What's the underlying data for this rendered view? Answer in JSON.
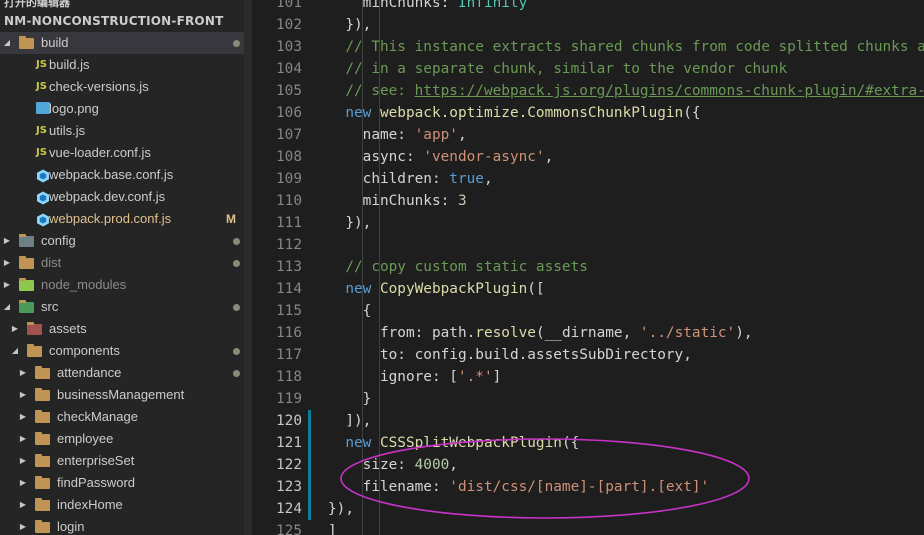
{
  "explorer": {
    "cut_header": "打开的编辑器",
    "project": "NM-NONCONSTRUCTION-FRONT",
    "items": [
      {
        "label": "build",
        "type": "folder",
        "level": 0,
        "open": true,
        "active": true,
        "status": "dot"
      },
      {
        "label": "build.js",
        "type": "js",
        "level": 1
      },
      {
        "label": "check-versions.js",
        "type": "js",
        "level": 1
      },
      {
        "label": "logo.png",
        "type": "image",
        "level": 1
      },
      {
        "label": "utils.js",
        "type": "js",
        "level": 1
      },
      {
        "label": "vue-loader.conf.js",
        "type": "js",
        "level": 1
      },
      {
        "label": "webpack.base.conf.js",
        "type": "webpack",
        "level": 1
      },
      {
        "label": "webpack.dev.conf.js",
        "type": "webpack",
        "level": 1
      },
      {
        "label": "webpack.prod.conf.js",
        "type": "webpack",
        "level": 1,
        "status": "M",
        "modified": true
      },
      {
        "label": "config",
        "type": "folder-config",
        "level": 0,
        "status": "dot"
      },
      {
        "label": "dist",
        "type": "folder",
        "level": 0,
        "dim": true,
        "status": "dot"
      },
      {
        "label": "node_modules",
        "type": "folder-node",
        "level": 0,
        "dim": true
      },
      {
        "label": "src",
        "type": "folder-src",
        "level": 0,
        "open": true,
        "status": "dot"
      },
      {
        "label": "assets",
        "type": "folder-assets",
        "level": 1
      },
      {
        "label": "components",
        "type": "folder",
        "level": 1,
        "open": true,
        "status": "dot"
      },
      {
        "label": "attendance",
        "type": "folder",
        "level": 2,
        "status": "dot"
      },
      {
        "label": "businessManagement",
        "type": "folder",
        "level": 2
      },
      {
        "label": "checkManage",
        "type": "folder",
        "level": 2
      },
      {
        "label": "employee",
        "type": "folder",
        "level": 2
      },
      {
        "label": "enterpriseSet",
        "type": "folder",
        "level": 2
      },
      {
        "label": "findPassword",
        "type": "folder",
        "level": 2
      },
      {
        "label": "indexHome",
        "type": "folder",
        "level": 2
      },
      {
        "label": "login",
        "type": "folder",
        "level": 2
      }
    ]
  },
  "editor": {
    "lines": [
      {
        "n": "101",
        "tokens": [
          [
            "p",
            "    minChunks: "
          ],
          [
            "cls",
            "Infinity"
          ]
        ]
      },
      {
        "n": "102",
        "tokens": [
          [
            "p",
            "  }),"
          ]
        ]
      },
      {
        "n": "103",
        "tokens": [
          [
            "cm",
            "  // This instance extracts shared chunks from code splitted chunks and bundles them"
          ]
        ]
      },
      {
        "n": "104",
        "tokens": [
          [
            "cm",
            "  // in a separate chunk, similar to the vendor chunk"
          ]
        ]
      },
      {
        "n": "105",
        "tokens": [
          [
            "cm",
            "  // see: "
          ],
          [
            "link",
            "https://webpack.js.org/plugins/commons-chunk-plugin/#extra-async-commons-chunk"
          ]
        ]
      },
      {
        "n": "106",
        "tokens": [
          [
            "kw",
            "  new "
          ],
          [
            "fn",
            "webpack.optimize.CommonsChunkPlugin"
          ],
          [
            "p",
            "({"
          ]
        ]
      },
      {
        "n": "107",
        "tokens": [
          [
            "p",
            "    name: "
          ],
          [
            "str",
            "'app'"
          ],
          [
            "p",
            ","
          ]
        ]
      },
      {
        "n": "108",
        "tokens": [
          [
            "p",
            "    async: "
          ],
          [
            "str",
            "'vendor-async'"
          ],
          [
            "p",
            ","
          ]
        ]
      },
      {
        "n": "109",
        "tokens": [
          [
            "p",
            "    children: "
          ],
          [
            "kw",
            "true"
          ],
          [
            "p",
            ","
          ]
        ]
      },
      {
        "n": "110",
        "tokens": [
          [
            "p",
            "    minChunks: "
          ],
          [
            "num",
            "3"
          ]
        ]
      },
      {
        "n": "111",
        "tokens": [
          [
            "p",
            "  }),"
          ]
        ]
      },
      {
        "n": "112",
        "tokens": [
          [
            "p",
            ""
          ]
        ]
      },
      {
        "n": "113",
        "tokens": [
          [
            "cm",
            "  // copy custom static assets"
          ]
        ]
      },
      {
        "n": "114",
        "tokens": [
          [
            "kw",
            "  new "
          ],
          [
            "fn",
            "CopyWebpackPlugin"
          ],
          [
            "p",
            "(["
          ]
        ]
      },
      {
        "n": "115",
        "tokens": [
          [
            "p",
            "    {"
          ]
        ]
      },
      {
        "n": "116",
        "tokens": [
          [
            "p",
            "      from: path."
          ],
          [
            "fn",
            "resolve"
          ],
          [
            "p",
            "(__dirname, "
          ],
          [
            "str",
            "'../static'"
          ],
          [
            "p",
            "),"
          ]
        ]
      },
      {
        "n": "117",
        "tokens": [
          [
            "p",
            "      to: config.build.assetsSubDirectory,"
          ]
        ]
      },
      {
        "n": "118",
        "tokens": [
          [
            "p",
            "      ignore: ["
          ],
          [
            "str",
            "'.*'"
          ],
          [
            "p",
            "]"
          ]
        ]
      },
      {
        "n": "119",
        "tokens": [
          [
            "p",
            "    }"
          ]
        ]
      },
      {
        "n": "120",
        "tokens": [
          [
            "p",
            "  ]),"
          ]
        ]
      },
      {
        "n": "121",
        "tokens": [
          [
            "kw",
            "  new "
          ],
          [
            "fn",
            "CSSSplitWebpackPlugin"
          ],
          [
            "p",
            "({"
          ]
        ]
      },
      {
        "n": "122",
        "tokens": [
          [
            "p",
            "    size: "
          ],
          [
            "num",
            "4000"
          ],
          [
            "p",
            ","
          ]
        ]
      },
      {
        "n": "123",
        "tokens": [
          [
            "p",
            "    filename: "
          ],
          [
            "str",
            "'dist/css/[name]-[part].[ext]'"
          ]
        ]
      },
      {
        "n": "124",
        "tokens": [
          [
            "p",
            "}),"
          ]
        ]
      },
      {
        "n": "125",
        "tokens": [
          [
            "p",
            "]"
          ]
        ]
      }
    ],
    "git_changed_lines": [
      "120",
      "121",
      "122",
      "123",
      "124"
    ],
    "annotation_color": "#c832c8"
  },
  "colors": {
    "keyword": "#569cd6",
    "string": "#ce9178",
    "comment": "#6a9955",
    "function": "#dcdcaa",
    "number": "#b5cea8",
    "modified": "#e2c08d"
  }
}
